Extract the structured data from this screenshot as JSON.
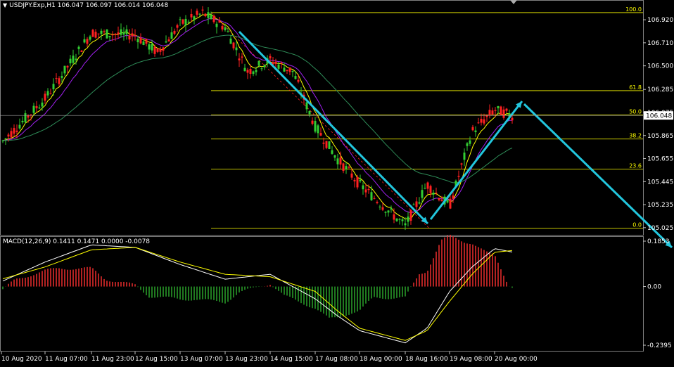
{
  "header": {
    "symbol": "USDJPY.Exp,H1",
    "ohlc": "106.047 106.097 106.014 106.048"
  },
  "macd_header": {
    "label": "MACD(12,26,9)",
    "values": "0.1411 0.1471 0.0000 -0.0078"
  },
  "price_axis": {
    "ticks": [
      "106.920",
      "106.710",
      "106.500",
      "106.285",
      "106.075",
      "105.865",
      "105.655",
      "105.445",
      "105.235",
      "105.025"
    ],
    "current_price": "106.048"
  },
  "macd_axis": {
    "ticks": [
      "0.1853",
      "0.00",
      "-0.2395"
    ]
  },
  "time_axis": {
    "ticks": [
      "10 Aug 2020",
      "11 Aug 07:00",
      "11 Aug 23:00",
      "12 Aug 15:00",
      "13 Aug 07:00",
      "13 Aug 23:00",
      "14 Aug 15:00",
      "17 Aug 08:00",
      "18 Aug 00:00",
      "18 Aug 16:00",
      "19 Aug 08:00",
      "20 Aug 00:00"
    ]
  },
  "fibonacci": {
    "levels": [
      "100.0",
      "61.8",
      "50.0",
      "38.2",
      "23.6",
      "0.0"
    ],
    "color": "#ffff00"
  },
  "colors": {
    "background": "#000000",
    "bull_candle": "#32cd32",
    "bear_candle": "#ff2020",
    "arrow": "#22c6dd",
    "ma_fast": "#ffff00",
    "ma_mid": "#a020f0",
    "ma_slow": "#2e8b57",
    "macd_hist_up": "#ff3030",
    "macd_hist_down": "#2fae2f",
    "macd_main": "#ffffff",
    "macd_signal": "#ffff00"
  },
  "chart_data": [
    {
      "type": "candlestick",
      "title": "USDJPY.Exp,H1",
      "ylim": [
        105.0,
        107.05
      ],
      "price_path": [
        {
          "x": "10 Aug 2020",
          "y": 105.8
        },
        {
          "x": "11 Aug 07:00",
          "y": 106.2
        },
        {
          "x": "11 Aug 23:00",
          "y": 106.8
        },
        {
          "x": "12 Aug 15:00",
          "y": 106.78
        },
        {
          "x": "12 Aug 23:00",
          "y": 106.62
        },
        {
          "x": "13 Aug 07:00",
          "y": 106.88
        },
        {
          "x": "13 Aug 15:00",
          "y": 106.98
        },
        {
          "x": "13 Aug 23:00",
          "y": 106.85
        },
        {
          "x": "14 Aug 07:00",
          "y": 106.45
        },
        {
          "x": "14 Aug 15:00",
          "y": 106.55
        },
        {
          "x": "16 Aug 23:00",
          "y": 106.45
        },
        {
          "x": "17 Aug 08:00",
          "y": 105.95
        },
        {
          "x": "17 Aug 16:00",
          "y": 105.65
        },
        {
          "x": "18 Aug 00:00",
          "y": 105.42
        },
        {
          "x": "18 Aug 16:00",
          "y": 105.04
        },
        {
          "x": "19 Aug 00:00",
          "y": 105.42
        },
        {
          "x": "19 Aug 08:00",
          "y": 105.22
        },
        {
          "x": "19 Aug 16:00",
          "y": 105.9
        },
        {
          "x": "20 Aug 00:00",
          "y": 106.1
        },
        {
          "x": "20 Aug 04:00",
          "y": 106.048
        }
      ],
      "fibonacci_retracement": [
        {
          "level": "100.0",
          "price": 106.985
        },
        {
          "level": "61.8",
          "price": 106.274
        },
        {
          "level": "50.0",
          "price": 106.053
        },
        {
          "level": "38.2",
          "price": 105.833
        },
        {
          "level": "23.6",
          "price": 105.56
        },
        {
          "level": "0.0",
          "price": 105.02
        }
      ]
    },
    {
      "type": "line",
      "title": "MACD(12,26,9)",
      "ylim": [
        -0.2395,
        0.1853
      ],
      "series": [
        {
          "name": "MACD",
          "values": [
            0.02,
            0.1,
            0.17,
            0.16,
            0.09,
            0.03,
            0.05,
            -0.05,
            -0.12,
            -0.18,
            -0.23,
            -0.17,
            -0.02,
            0.08,
            0.155,
            0.141
          ]
        },
        {
          "name": "Signal",
          "values": [
            0.03,
            0.08,
            0.15,
            0.16,
            0.1,
            0.05,
            0.04,
            -0.02,
            -0.1,
            -0.17,
            -0.22,
            -0.18,
            -0.06,
            0.05,
            0.14,
            0.147
          ]
        }
      ],
      "x": [
        "10 Aug 2020",
        "11 Aug 07:00",
        "11 Aug 23:00",
        "12 Aug 15:00",
        "13 Aug 07:00",
        "13 Aug 23:00",
        "14 Aug 15:00",
        "17 Aug 08:00",
        "17 Aug 16:00",
        "18 Aug 00:00",
        "18 Aug 16:00",
        "19 Aug 00:00",
        "19 Aug 08:00",
        "19 Aug 16:00",
        "20 Aug 00:00",
        "20 Aug 04:00"
      ]
    }
  ]
}
